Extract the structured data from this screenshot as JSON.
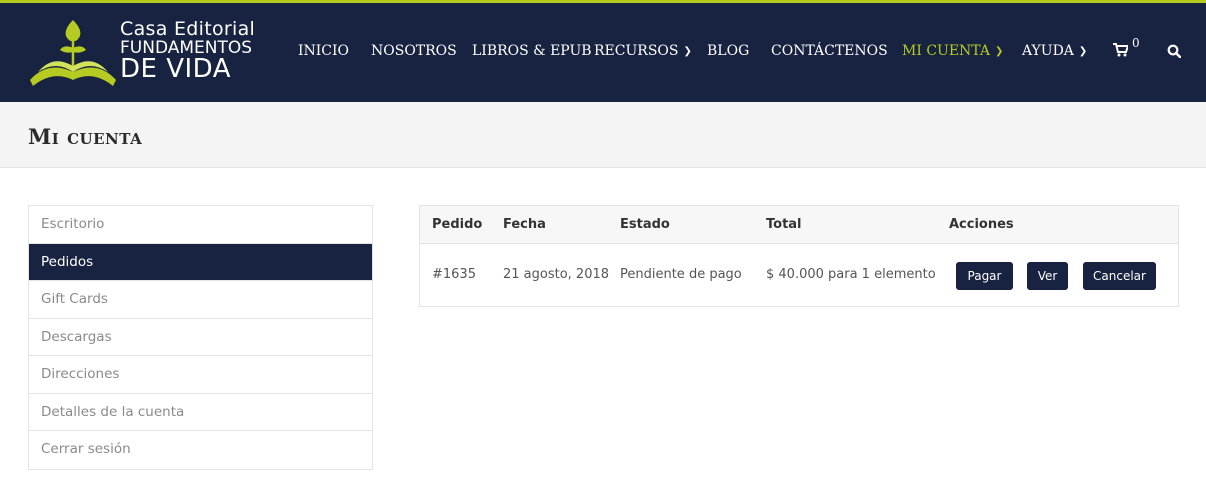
{
  "colors": {
    "navy": "#172341",
    "accent": "#b6cb22",
    "title_bg": "#f4f4f4"
  },
  "logo": {
    "line1": "Casa Editorial",
    "line2": "FUNDAMENTOS",
    "line3": "DE VIDA"
  },
  "nav": {
    "items": [
      {
        "label": "INICIO"
      },
      {
        "label": "NOSOTROS"
      },
      {
        "label": "LIBROS & EPUB"
      },
      {
        "label": "RECURSOS"
      },
      {
        "label": "BLOG"
      },
      {
        "label": "CONTÁCTENOS"
      },
      {
        "label": "MI CUENTA"
      },
      {
        "label": "AYUDA"
      }
    ],
    "cart_count": "0",
    "icons": [
      "cart-icon",
      "search-icon",
      "chevron-down-icon"
    ]
  },
  "page": {
    "title": "Mi cuenta"
  },
  "account_menu": {
    "items": [
      {
        "label": "Escritorio"
      },
      {
        "label": "Pedidos"
      },
      {
        "label": "Gift Cards"
      },
      {
        "label": "Descargas"
      },
      {
        "label": "Direcciones"
      },
      {
        "label": "Detalles de la cuenta"
      },
      {
        "label": "Cerrar sesión"
      }
    ],
    "active": "Pedidos"
  },
  "orders": {
    "headers": {
      "order": "Pedido",
      "date": "Fecha",
      "status": "Estado",
      "total": "Total",
      "actions": "Acciones"
    },
    "rows": [
      {
        "order": "#1635",
        "date": "21 agosto, 2018",
        "status": "Pendiente de pago",
        "total": "$ 40.000 para 1 elemento",
        "actions": {
          "pay": "Pagar",
          "view": "Ver",
          "cancel": "Cancelar"
        }
      }
    ]
  }
}
